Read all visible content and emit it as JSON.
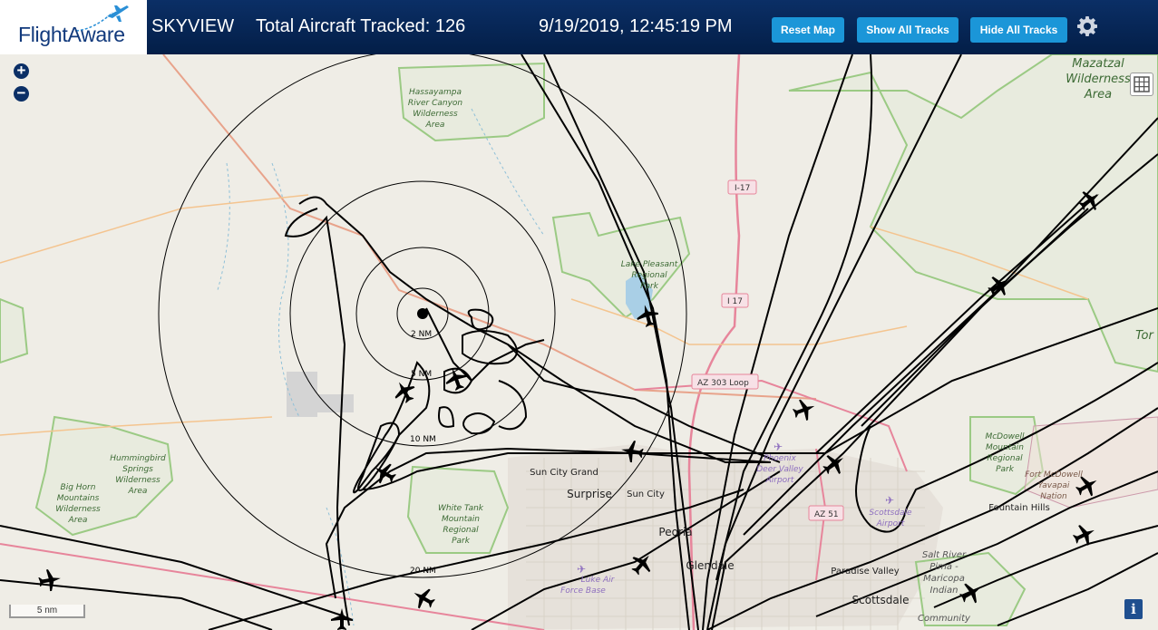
{
  "header": {
    "logo_text": "FlightAware",
    "app_name": "SKYVIEW",
    "aircraft_tracked": "Total Aircraft Tracked: 126",
    "datetime": "9/19/2019, 12:45:19 PM",
    "buttons": {
      "reset": "Reset Map",
      "show_all": "Show All Tracks",
      "hide_all": "Hide All Tracks"
    },
    "settings_icon": "gear-icon"
  },
  "controls": {
    "zoom_in": "+",
    "zoom_out": "−",
    "scale": "5 nm",
    "info": "i",
    "layers_icon": "grid-icon"
  },
  "rings": [
    "2 NM",
    "5 NM",
    "10 NM",
    "20 NM"
  ],
  "map_labels": {
    "hassayampa": [
      "Hassayampa",
      "River Canyon",
      "Wilderness",
      "Area"
    ],
    "lake_pleasant": [
      "Lake Pleasant",
      "Regional",
      "Park"
    ],
    "hummingbird": [
      "Hummingbird",
      "Springs",
      "Wilderness",
      "Area"
    ],
    "big_horn": [
      "Big Horn",
      "Mountains",
      "Wilderness",
      "Area"
    ],
    "white_tank": [
      "White Tank",
      "Mountain",
      "Regional",
      "Park"
    ],
    "luke": [
      "Luke Air",
      "Force Base"
    ],
    "mcdowell": [
      "McDowell",
      "Mountain",
      "Regional",
      "Park"
    ],
    "fort_mcdowell": [
      "Fort McDowell",
      "Yavapai",
      "Nation"
    ],
    "salt_river": [
      "Salt River",
      "Pima -",
      "Maricopa",
      "Indian",
      "Community"
    ],
    "mazatzal": [
      "Mazatzal",
      "Wilderness",
      "Area"
    ],
    "sun_city_grand": "Sun City Grand",
    "surprise": "Surprise",
    "sun_city": "Sun City",
    "peoria": "Peoria",
    "glendale": "Glendale",
    "paradise_valley": "Paradise Valley",
    "scottsdale": "Scottsdale",
    "scottsdale_airport": [
      "Scottsdale",
      "Airport"
    ],
    "phoenix_deer_valley": [
      "Phoenix",
      "Deer Valley",
      "Airport"
    ],
    "fountain_hills": "Fountain Hills",
    "tonto": "Tor",
    "i17_a": "I-17",
    "i17_b": "I 17",
    "az303": "AZ 303 Loop",
    "az51": "AZ 51"
  },
  "colors": {
    "header_bg": "#0b2f66",
    "button_bg": "#1b96d8",
    "map_bg": "#efede6",
    "track": "#000000"
  }
}
